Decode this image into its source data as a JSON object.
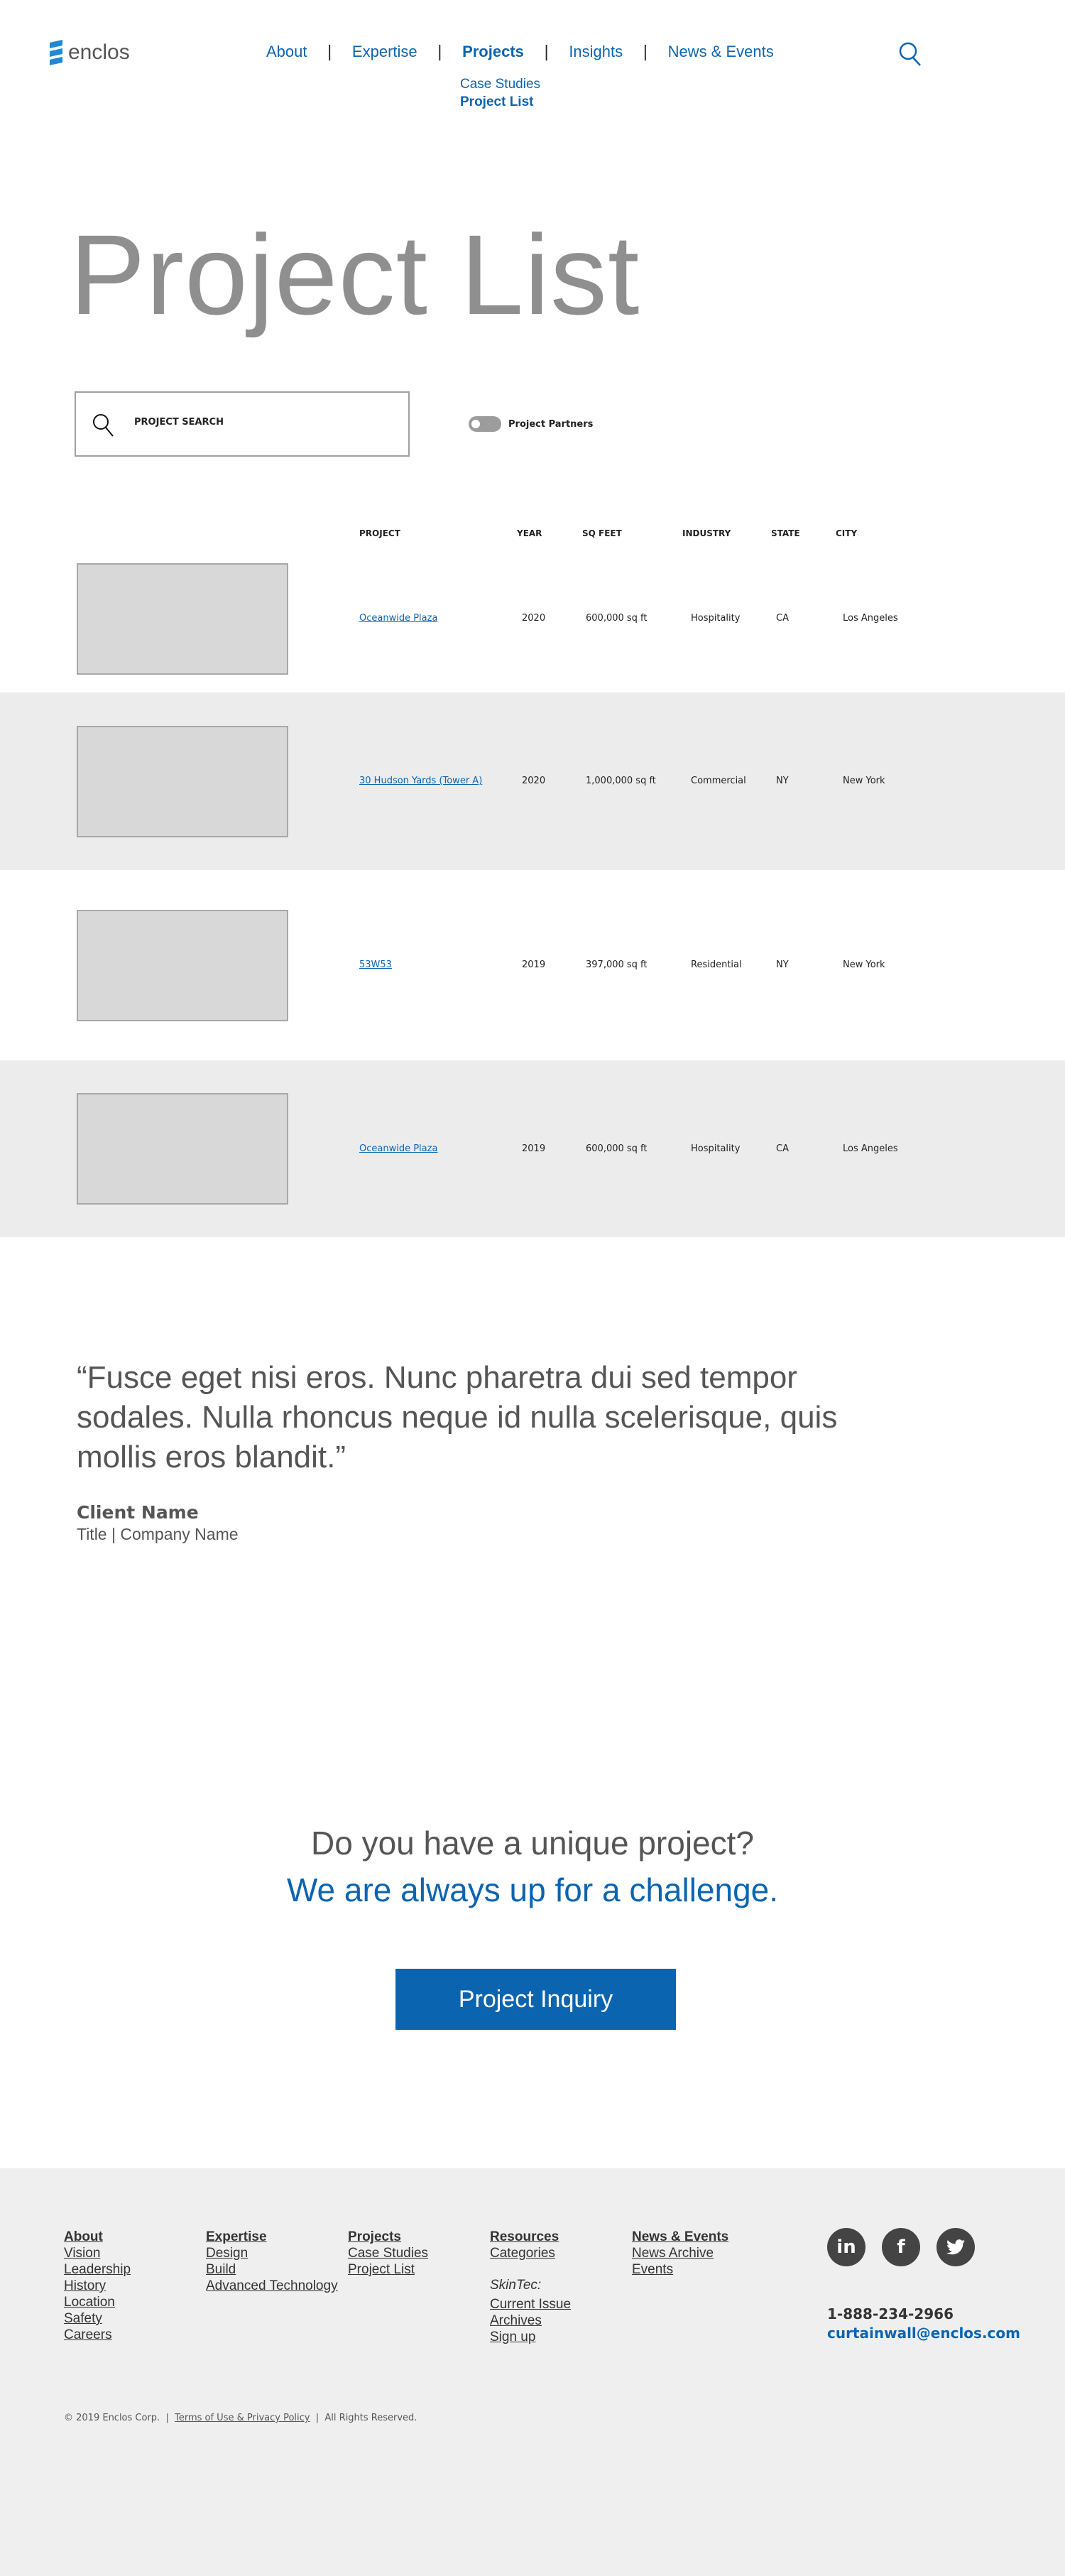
{
  "brand": {
    "name": "enclos",
    "accent": "#0b64b0"
  },
  "nav": {
    "items": [
      "About",
      "Expertise",
      "Projects",
      "Insights",
      "News & Events"
    ],
    "active": "Projects",
    "sub": [
      "Case Studies",
      "Project List"
    ],
    "search_icon": "search-icon"
  },
  "page": {
    "title": "Project List"
  },
  "filters": {
    "search_placeholder": "PROJECT SEARCH",
    "toggle_label": "Project Partners",
    "toggle_on": false
  },
  "table": {
    "headers": [
      "PROJECT",
      "YEAR",
      "SQ FEET",
      "INDUSTRY",
      "STATE",
      "CITY"
    ],
    "rows": [
      [
        "Oceanwide Plaza",
        "2020",
        "600,000 sq ft",
        "Hospitality",
        "CA",
        "Los Angeles"
      ],
      [
        "30 Hudson Yards (Tower A)",
        "2020",
        "1,000,000 sq ft",
        "Commercial",
        "NY",
        "New York"
      ],
      [
        "53W53",
        "2019",
        "397,000 sq ft",
        "Residential",
        "NY",
        "New York"
      ],
      [
        "Oceanwide Plaza",
        "2019",
        "600,000 sq ft",
        "Hospitality",
        "CA",
        "Los Angeles"
      ]
    ]
  },
  "testimonial": {
    "quote": "“Fusce eget nisi eros. Nunc pharetra dui sed tempor sodales. Nulla rhoncus neque id nulla scelerisque, quis mollis eros blandit.”",
    "name": "Client Name",
    "title": "Title | Company Name"
  },
  "cta": {
    "line1": "Do you have a unique project?",
    "line2": "We are always up for a challenge.",
    "button": "Project Inquiry"
  },
  "footer": {
    "columns": [
      {
        "heading": "About",
        "links": [
          "Vision",
          "Leadership",
          "History",
          "Location",
          "Safety",
          "Careers"
        ]
      },
      {
        "heading": "Expertise",
        "links": [
          "Design",
          "Build",
          "Advanced Technology"
        ]
      },
      {
        "heading": "Projects",
        "links": [
          "Case Studies",
          "Project List"
        ]
      },
      {
        "heading": "Resources",
        "links": [
          "Categories"
        ],
        "subheading": "SkinTec:",
        "sublinks": [
          "Current Issue",
          "Archives",
          "Sign up"
        ]
      },
      {
        "heading": "News & Events",
        "links": [
          "News Archive",
          "Events"
        ]
      }
    ],
    "social": [
      "linkedin-icon",
      "facebook-icon",
      "twitter-icon"
    ],
    "phone": "1-888-234-2966",
    "email": "curtainwall@enclos.com",
    "copyright": "© 2019 Enclos Corp.",
    "terms": "Terms of Use & Privacy Policy",
    "rights": "All Rights Reserved."
  }
}
